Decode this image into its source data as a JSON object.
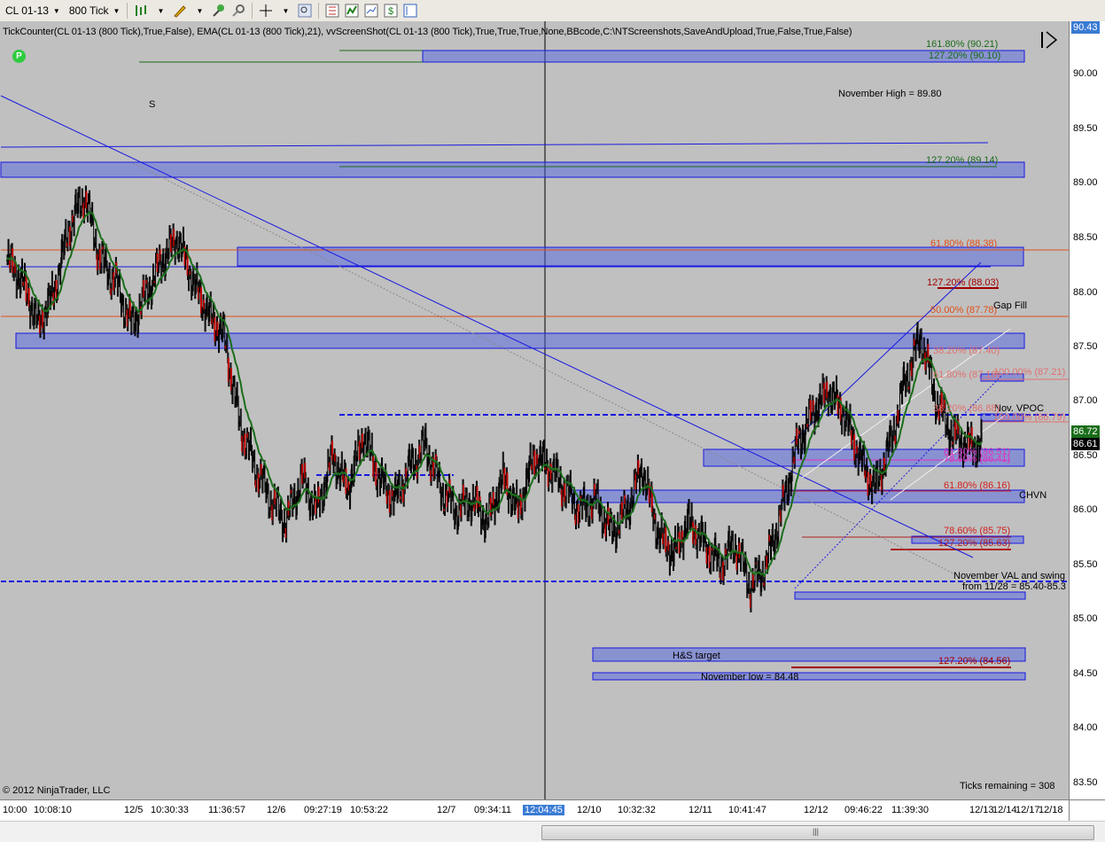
{
  "toolbar": {
    "instrument": "CL 01-13",
    "period": "800 Tick",
    "icons": [
      "bars-type-icon",
      "draw-pen-icon",
      "pin-icon",
      "magnify-cursor-icon",
      "crosshair-icon",
      "zoom-icon",
      "properties-icon",
      "indicators-icon",
      "strategies-icon",
      "money-icon",
      "data-box-icon"
    ]
  },
  "chart": {
    "indicator_line": "TickCounter(CL 01-13 (800 Tick),True,False), EMA(CL 01-13 (800 Tick),21), vvScreenShot(CL 01-13 (800 Tick),True,True,True,None,BBcode,C:\\NTScreenshots,SaveAndUpload,True,False,True,False)",
    "copyright": "© 2012 NinjaTrader, LLC",
    "ticks_remaining": "Ticks remaining = 308",
    "marker_s": "S",
    "logo_letter": "P",
    "annotations": {
      "fib_161_top": "161.80% (90.21)",
      "fib_127_top": "127.20% (90.10)",
      "nov_high": "November High = 89.80",
      "fib_127_89": "127.20% (89.14)",
      "fib_618_8838": "61.80% (88.38)",
      "fib_127_8803": "127.20% (88.03)",
      "fib_50_8778": "50.00% (87.78)",
      "gap_fill": "Gap Fill",
      "fib_382_8740": "38.20% (87.40)",
      "fib_618_8718": "61.80% (87.18)",
      "fib_100_8721": "100.00% (87.21)",
      "nov_vpoc": "Nov. VPOC",
      "fib_382_8688": "38.20% (86.88)",
      "fib_100_8679": "100.00% (86.79)",
      "fib_618_8651": "61.80% (86.51)",
      "fib_786_8641": "78.60% (86.41)",
      "fib_618_8616": "61.80% (86.16)",
      "chvn": "CHVN",
      "fib_786_8575": "78.60% (85.75)",
      "fib_127_8563": "127.20% (85.63)",
      "nov_val_1": "November VAL and swing",
      "nov_val_2": "from 11/28 = 85.40-85.3",
      "hs_target": "H&S target",
      "fib_127_8456": "127.20% (84.56)",
      "nov_low": "November low = 84.48"
    }
  },
  "price_axis": {
    "labels": [
      "90.00",
      "89.50",
      "89.00",
      "88.50",
      "88.00",
      "87.50",
      "87.00",
      "86.50",
      "86.00",
      "85.50",
      "85.00",
      "84.50",
      "84.00",
      "83.50"
    ],
    "top_value": "90.43",
    "current_high": "86.72",
    "current_last": "86.61"
  },
  "time_axis": {
    "labels": [
      "10:00",
      "10:08:10",
      "12/5",
      "10:30:33",
      "11:36:57",
      "12/6",
      "09:27:19",
      "10:53:22",
      "12/7",
      "09:34:11",
      "12:04:45",
      "12/10",
      "10:32:32",
      "12/11",
      "10:41:47",
      "12/12",
      "09:46:22",
      "11:39:30",
      "12/13",
      "12/14",
      "12/17",
      "12/18"
    ],
    "selected": "12:04:45"
  },
  "chart_data": {
    "type": "candlestick",
    "title": "",
    "series": [
      {
        "name": "CL 01-13 (800 Tick)",
        "close": [
          88.3,
          88.1,
          87.7,
          88.0,
          88.6,
          88.9,
          88.3,
          88.1,
          87.7,
          88.0,
          88.3,
          88.5,
          88.1,
          87.8,
          87.6,
          86.8,
          86.4,
          86.1,
          85.9,
          86.3,
          86.0,
          86.5,
          86.2,
          86.7,
          86.3,
          86.1,
          86.4,
          86.6,
          86.2,
          86.0,
          86.1,
          85.9,
          86.3,
          86.0,
          86.5,
          86.4,
          86.2,
          86.0,
          86.1,
          85.8,
          86.0,
          86.4,
          85.8,
          85.6,
          85.9,
          85.7,
          85.5,
          85.7,
          85.3,
          85.5,
          86.0,
          86.6,
          86.9,
          87.1,
          86.9,
          86.5,
          86.2,
          86.6,
          87.2,
          87.6,
          87.0,
          86.7,
          86.6
        ]
      },
      {
        "name": "EMA(21)"
      }
    ]
  }
}
